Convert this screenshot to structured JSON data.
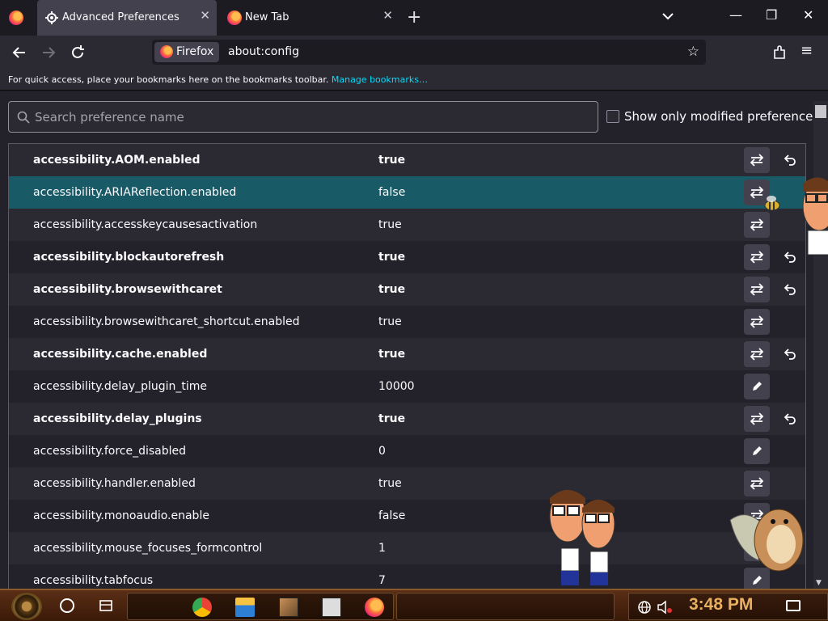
{
  "window": {
    "tabs": [
      {
        "label": "Advanced Preferences",
        "active": true
      },
      {
        "label": "New Tab",
        "active": false
      }
    ],
    "new_tab_symbol": "+",
    "close_symbol": "✕",
    "minimize_symbol": "—",
    "maximize_symbol": "❐",
    "window_close_symbol": "✕"
  },
  "navbar": {
    "identity_label": "Firefox",
    "url": "about:config",
    "star_symbol": "☆",
    "menu_symbol": "≡"
  },
  "bookmarks_bar": {
    "text": "For quick access, place your bookmarks here on the bookmarks toolbar.",
    "link": "Manage bookmarks…"
  },
  "config": {
    "search_placeholder": "Search preference name",
    "modified_only_label": "Show only modified preferences",
    "rows": [
      {
        "name": "accessibility.AOM.enabled",
        "value": "true",
        "modified": true,
        "action": "toggle",
        "reset": true
      },
      {
        "name": "accessibility.ARIAReflection.enabled",
        "value": "false",
        "modified": false,
        "action": "toggle",
        "reset": false,
        "selected": true
      },
      {
        "name": "accessibility.accesskeycausesactivation",
        "value": "true",
        "modified": false,
        "action": "toggle",
        "reset": false
      },
      {
        "name": "accessibility.blockautorefresh",
        "value": "true",
        "modified": true,
        "action": "toggle",
        "reset": true
      },
      {
        "name": "accessibility.browsewithcaret",
        "value": "true",
        "modified": true,
        "action": "toggle",
        "reset": true
      },
      {
        "name": "accessibility.browsewithcaret_shortcut.enabled",
        "value": "true",
        "modified": false,
        "action": "toggle",
        "reset": false
      },
      {
        "name": "accessibility.cache.enabled",
        "value": "true",
        "modified": true,
        "action": "toggle",
        "reset": true
      },
      {
        "name": "accessibility.delay_plugin_time",
        "value": "10000",
        "modified": false,
        "action": "edit",
        "reset": false
      },
      {
        "name": "accessibility.delay_plugins",
        "value": "true",
        "modified": true,
        "action": "toggle",
        "reset": true
      },
      {
        "name": "accessibility.force_disabled",
        "value": "0",
        "modified": false,
        "action": "edit",
        "reset": false
      },
      {
        "name": "accessibility.handler.enabled",
        "value": "true",
        "modified": false,
        "action": "toggle",
        "reset": false
      },
      {
        "name": "accessibility.monoaudio.enable",
        "value": "false",
        "modified": false,
        "action": "toggle",
        "reset": false
      },
      {
        "name": "accessibility.mouse_focuses_formcontrol",
        "value": "1",
        "modified": false,
        "action": "edit",
        "reset": false
      },
      {
        "name": "accessibility.tabfocus",
        "value": "7",
        "modified": false,
        "action": "edit",
        "reset": false
      }
    ]
  },
  "taskbar": {
    "clock": "3:48 PM",
    "apps": [
      "chrome-icon",
      "file-explorer-icon",
      "game-icon",
      "media-icon",
      "firefox-icon"
    ]
  },
  "colors": {
    "accent_link": "#00ddff",
    "selected_row": "#185a66",
    "clock": "#e8b060"
  }
}
